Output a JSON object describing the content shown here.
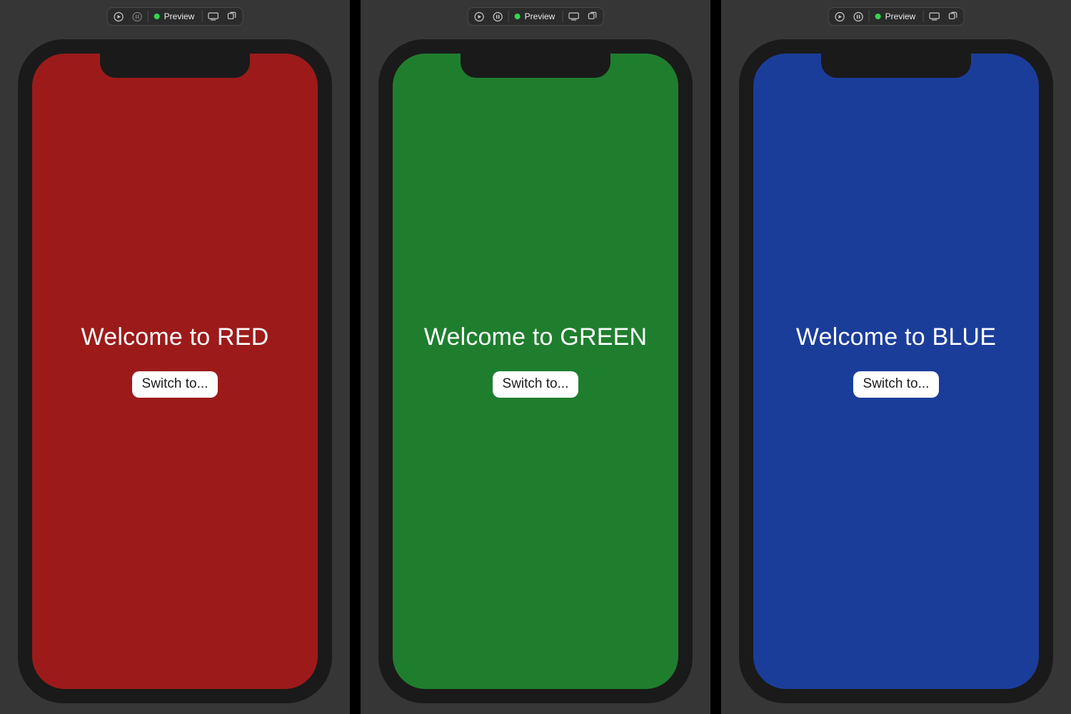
{
  "toolbar": {
    "preview_label": "Preview",
    "status_color": "#32d74b"
  },
  "panes": [
    {
      "title": "Welcome to RED",
      "button_label": "Switch to...",
      "bg_color": "#9c1b1a"
    },
    {
      "title": "Welcome to GREEN",
      "button_label": "Switch to...",
      "bg_color": "#1f7e2e"
    },
    {
      "title": "Welcome to BLUE",
      "button_label": "Switch to...",
      "bg_color": "#1b3d9a"
    }
  ]
}
